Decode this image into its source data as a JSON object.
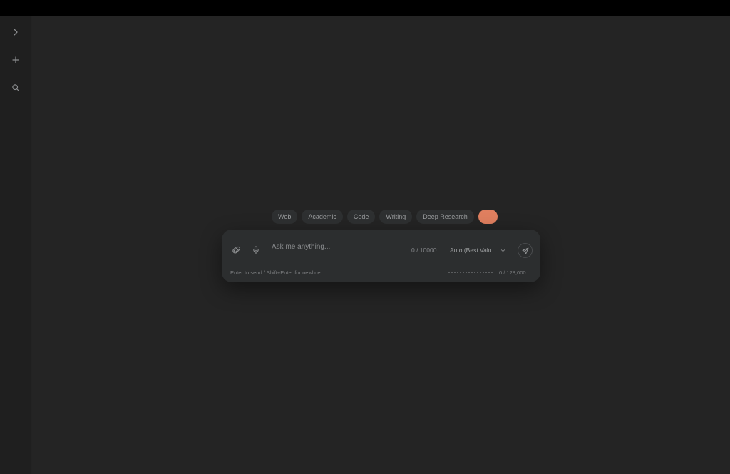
{
  "sidebar": {
    "items": [
      {
        "icon": "chevron-right-icon"
      },
      {
        "icon": "plus-icon"
      },
      {
        "icon": "search-icon"
      }
    ]
  },
  "chips": [
    "Web",
    "Academic",
    "Code",
    "Writing",
    "Deep Research"
  ],
  "accent_color": "#e07f5f",
  "composer": {
    "placeholder": "Ask me anything...",
    "value": "",
    "char_count": "0 / 10000",
    "model": "Auto (Best Valu...",
    "hint": "Enter to send / Shift+Enter for newline",
    "context_count": "0 / 128,000",
    "attach_icon": "paperclip-icon",
    "voice_icon": "microphone-icon",
    "send_icon": "send-icon"
  }
}
